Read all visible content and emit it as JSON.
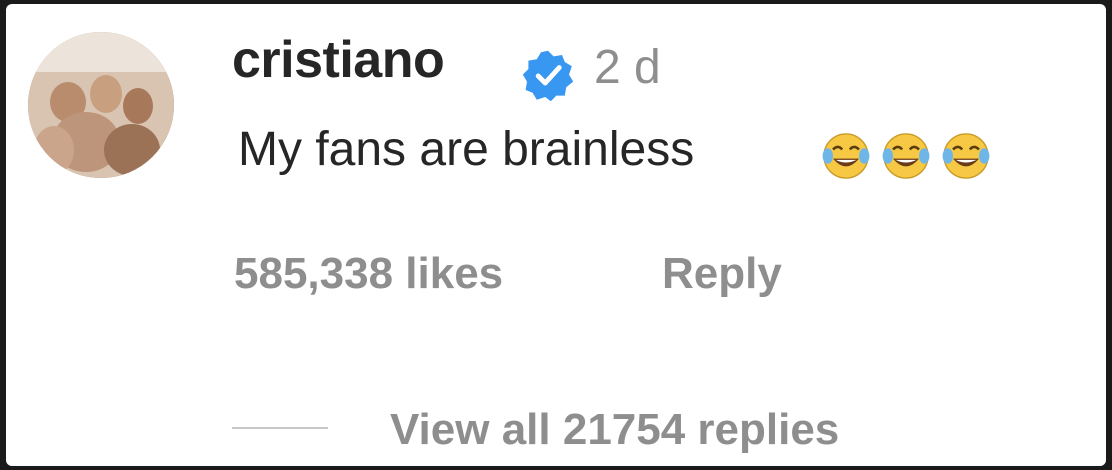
{
  "comment": {
    "username": "cristiano",
    "timestamp": "2 d",
    "text": "My fans are brainless",
    "emoji_count": 3,
    "emoji_name": "face-with-tears-of-joy",
    "likes_text": "585,338 likes",
    "reply_label": "Reply",
    "view_replies_label": "View all 21754 replies"
  },
  "colors": {
    "username": "#262626",
    "secondary": "#8e8e8e",
    "verified_blue": "#3897f0",
    "background": "#ffffff"
  },
  "icons": {
    "verified": "verified-badge-icon",
    "emoji": "face-with-tears-of-joy-icon"
  }
}
